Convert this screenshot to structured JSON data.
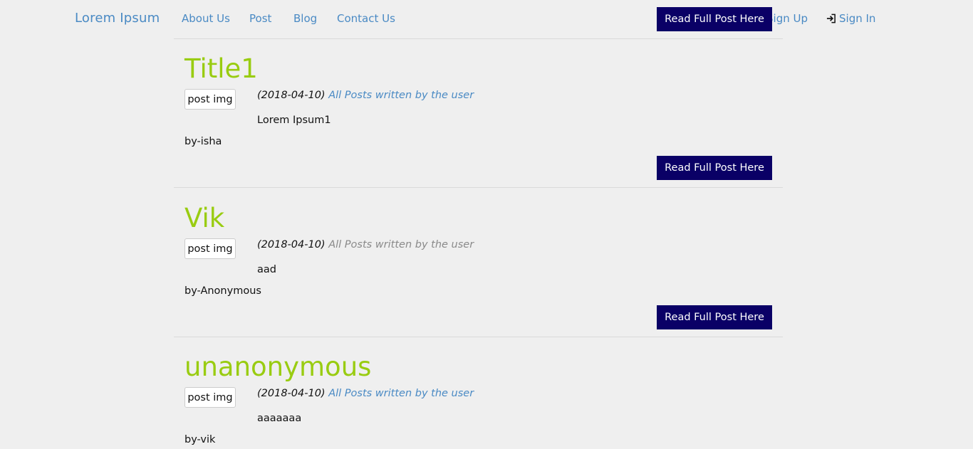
{
  "navbar": {
    "brand": "Lorem Ipsum",
    "links": [
      "About Us",
      "Post",
      "Blog",
      "Contact Us"
    ],
    "signup_label": "Sign Up",
    "signin_label": "Sign In",
    "top_button_label": "Read Full Post Here"
  },
  "posts": [
    {
      "title": "Title1",
      "img_label": "post img",
      "date": "(2018-04-10)",
      "user_link": "All Posts written by the user",
      "excerpt": "Lorem Ipsum1",
      "author": "by-isha",
      "button_label": "Read Full Post Here"
    },
    {
      "title": "Vik",
      "img_label": "post img",
      "date": "(2018-04-10)",
      "user_link": "All Posts written by the user",
      "excerpt": "aad",
      "author": "by-Anonymous",
      "button_label": "Read Full Post Here"
    },
    {
      "title": "unanonymous",
      "img_label": "post img",
      "date": "(2018-04-10)",
      "user_link": "All Posts written by the user",
      "excerpt": "aaaaaaa",
      "author": "by-vik"
    }
  ],
  "colors": {
    "background": "#efefef",
    "link": "#4a8ac4",
    "title": "#99cc11",
    "button": "#0a0066",
    "muted_link": "#8a8a8a"
  }
}
